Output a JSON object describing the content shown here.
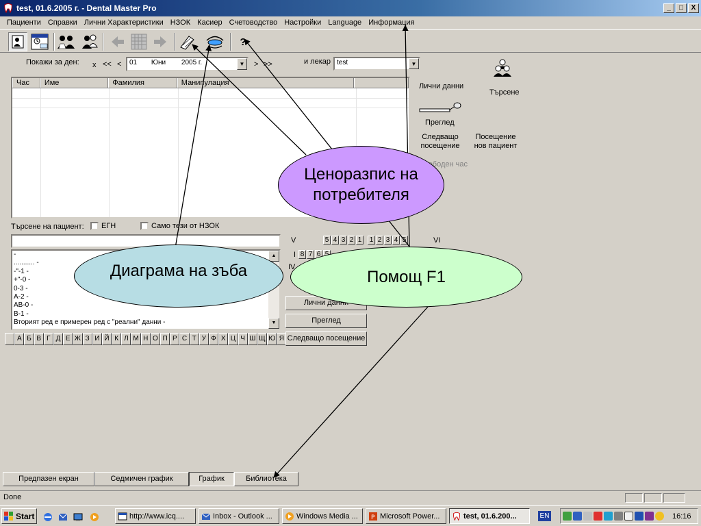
{
  "window": {
    "title": "test, 01.6.2005 г. - Dental Master Pro",
    "minimize": "_",
    "maximize": "□",
    "close": "X"
  },
  "menu": [
    "Пациенти",
    "Справки",
    "Лични Характеристики",
    "НЗОК",
    "Касиер",
    "Счетоводство",
    "Настройки",
    "Language",
    "Информация"
  ],
  "toolbar": {
    "help_glyph": "?"
  },
  "day_selector": {
    "label": "Покажи за ден:",
    "nav_clear": "x",
    "nav_prev_week": "<<",
    "nav_prev": "<",
    "day": "01",
    "month": "Юни",
    "year": "2005 г.",
    "nav_next": ">",
    "nav_next_week": ">>",
    "doctor_label": "и лекар",
    "doctor_value": "test"
  },
  "grid": {
    "columns": [
      "Час",
      "Име",
      "Фамилия",
      "Манипулация"
    ]
  },
  "right_panel": {
    "personal_data": "Лични данни",
    "search": "Търсене",
    "examination": "Преглед",
    "next_visit": "Следващо посещение",
    "new_patient_visit": "Посещение нов пациент",
    "free_hour": "Свободен час"
  },
  "patient_search": {
    "label": "Търсене на пациент:",
    "egn_label": "ЕГН",
    "nzok_only_label": "Само тези от НЗОК",
    "input_value": ""
  },
  "list_lines": [
    " -",
    "........... -",
    "-\"-1 -",
    "+\"-0 -",
    "0-3 -",
    "A-2 -",
    "AB-0 -",
    "B-1 -",
    "Вторият ред е примерен ред с \"реални\" данни -"
  ],
  "alphabet": [
    "А",
    "Б",
    "В",
    "Г",
    "Д",
    "Е",
    "Ж",
    "З",
    "И",
    "Й",
    "К",
    "Л",
    "М",
    "Н",
    "О",
    "П",
    "Р",
    "С",
    "Т",
    "У",
    "Ф",
    "Х",
    "Ц",
    "Ч",
    "Ш",
    "Щ",
    "Ю",
    "Я"
  ],
  "dental_chart": {
    "quadrant_v": "V",
    "quadrant_vi": "VI",
    "quadrant_i": "I",
    "quadrant_iv": "IV",
    "upper_left": [
      "5",
      "4",
      "3",
      "2",
      "1"
    ],
    "upper_right": [
      "1",
      "2",
      "3",
      "4",
      "5"
    ],
    "row_i": [
      "8",
      "7",
      "6",
      "5"
    ]
  },
  "action_buttons": [
    "Лични данни",
    "Преглед",
    "Следващо посещение"
  ],
  "bottom_tabs": [
    "Предпазен екран",
    "Седмичен график",
    "График",
    "Библиотека"
  ],
  "status": {
    "text": "Done"
  },
  "taskbar": {
    "start": "Start",
    "tasks": [
      "http://www.icq....",
      "Inbox - Outlook ...",
      "Windows Media ...",
      "Microsoft Power...",
      "test, 01.6.200..."
    ],
    "lang": "EN",
    "clock": "16:16"
  },
  "annotations": {
    "price_list": "Ценоразпис на потребителя",
    "tooth_diagram": "Диаграма на зъба",
    "help": "Помощ F1"
  },
  "colors": {
    "title_gradient_start": "#0a246a",
    "bubble_purple": "#cc99ff",
    "bubble_teal": "#b7dde4",
    "bubble_green": "#ccffcc"
  }
}
